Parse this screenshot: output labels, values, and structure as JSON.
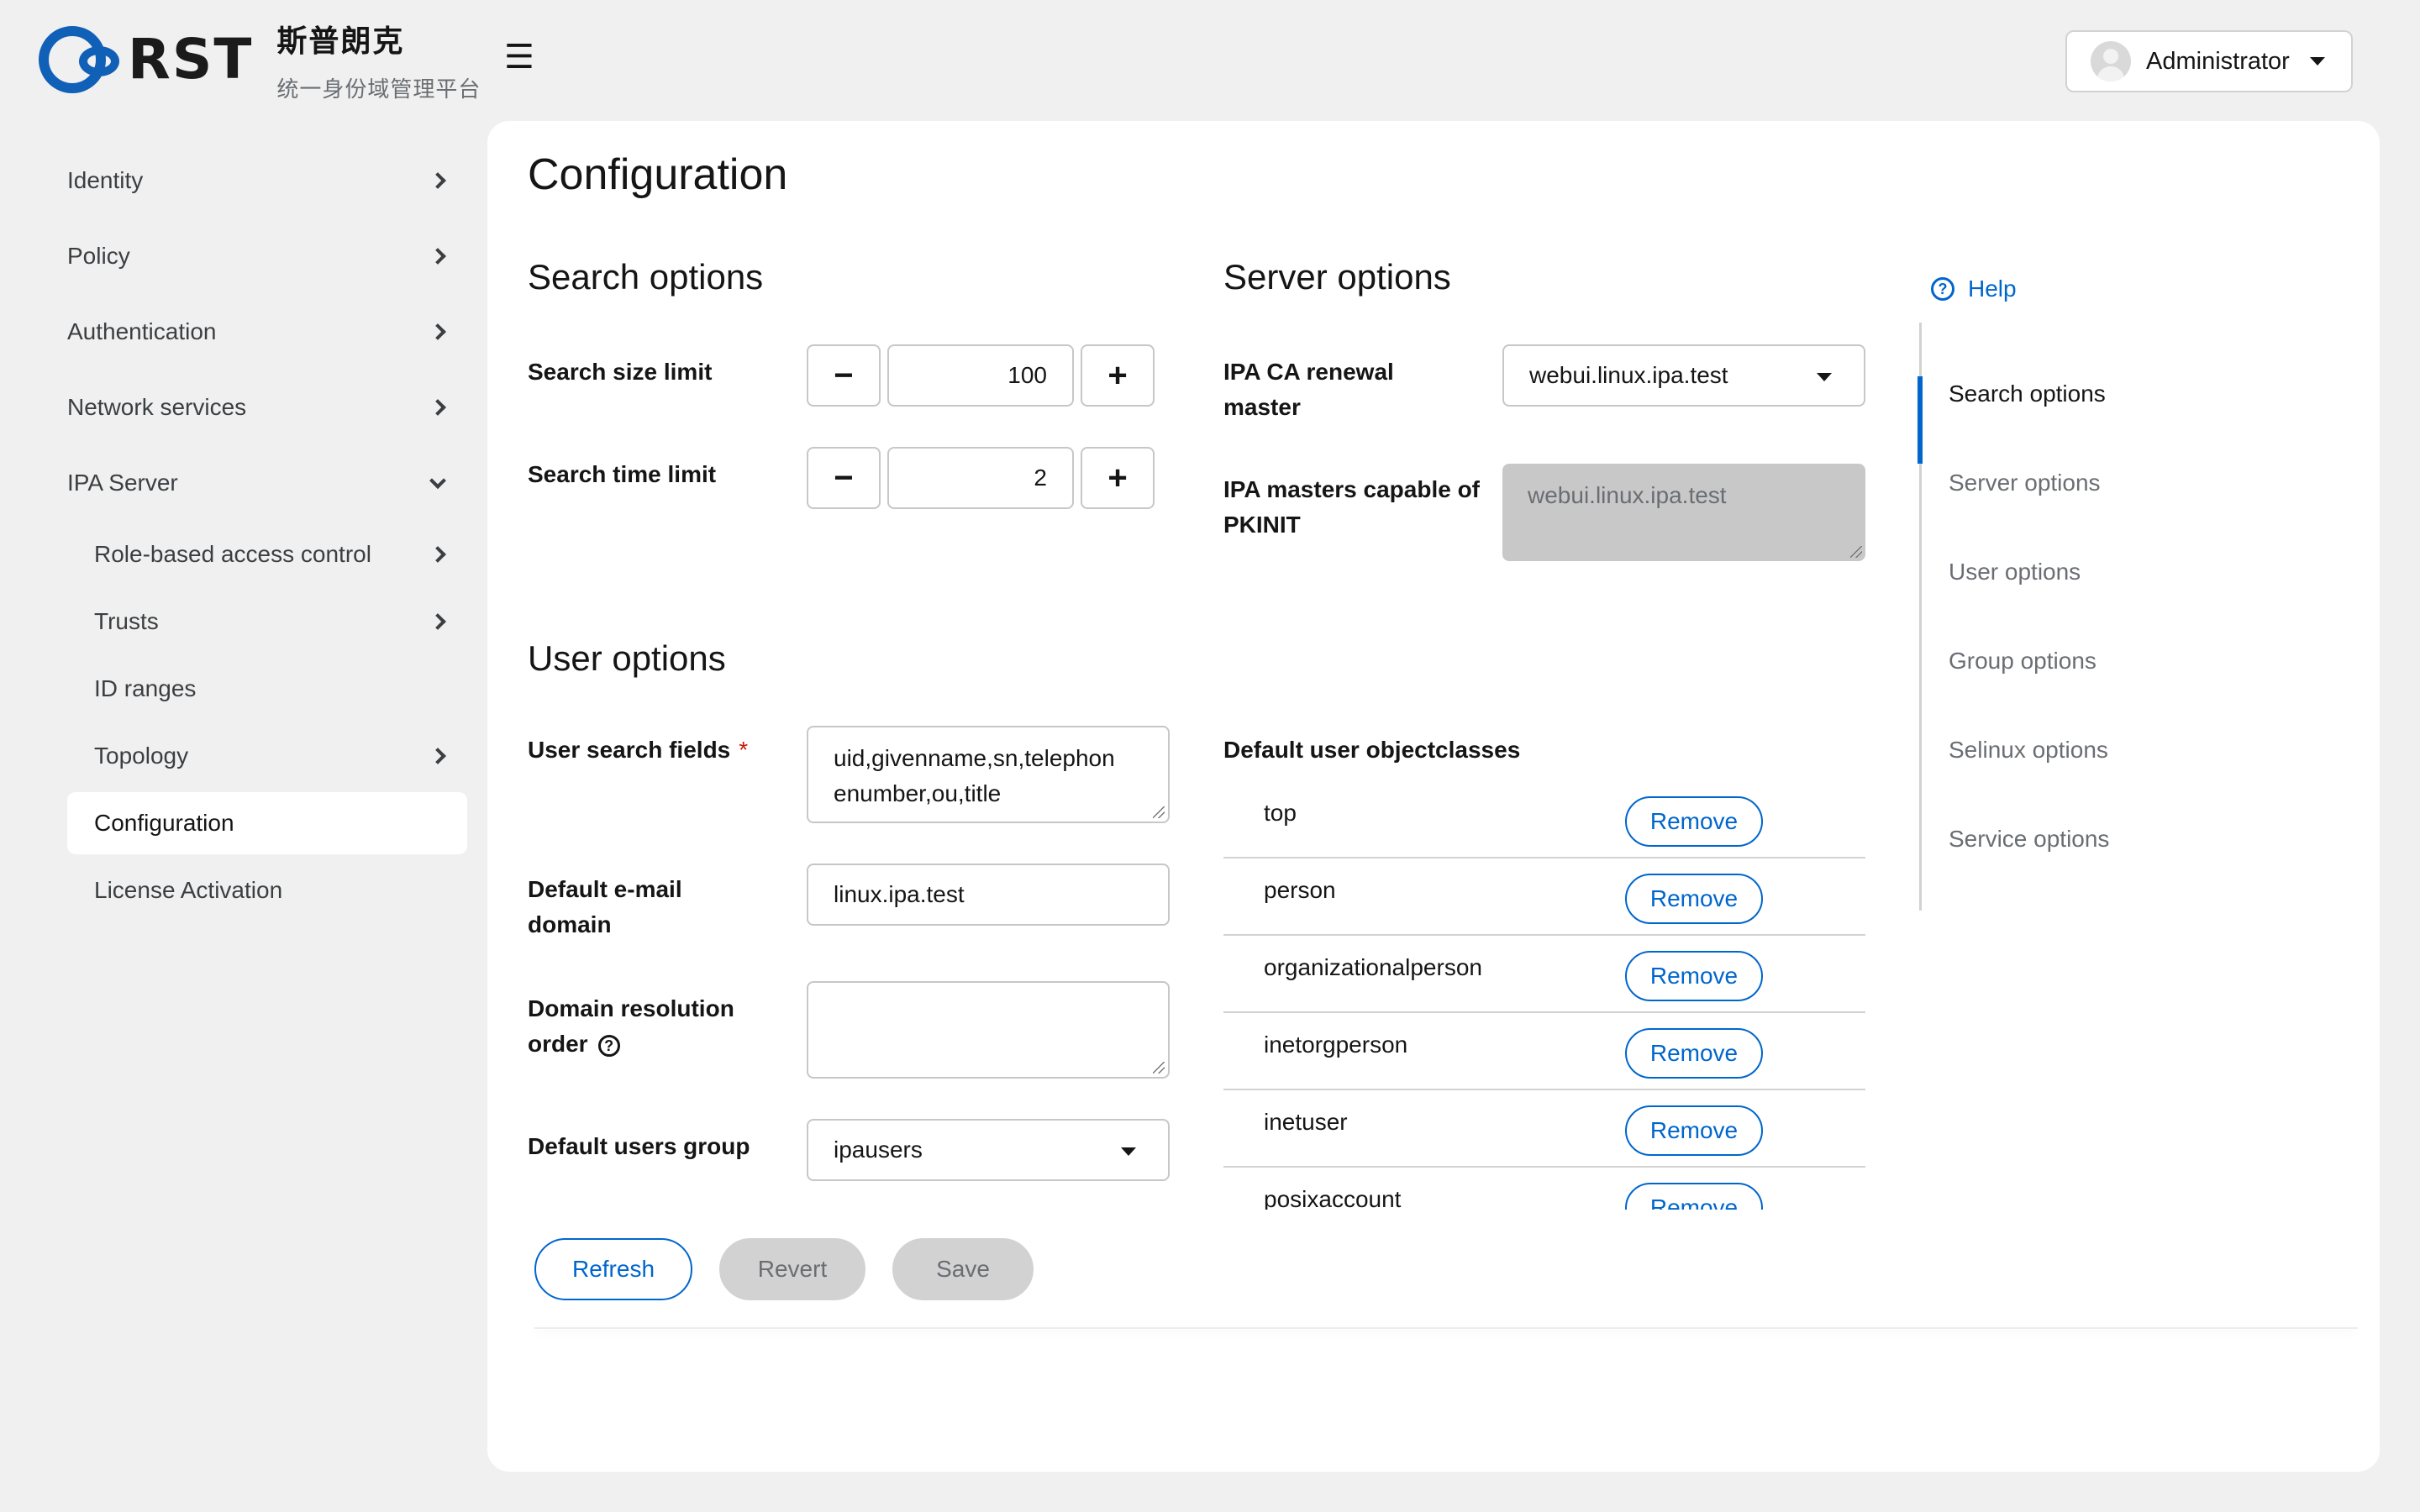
{
  "brand": {
    "logo_text": "RST",
    "name_cn": "斯普朗克",
    "subtitle_cn": "统一身份域管理平台"
  },
  "header": {
    "menu_icon": "☰",
    "user": "Administrator"
  },
  "sidebar": {
    "items": [
      {
        "label": "Identity"
      },
      {
        "label": "Policy"
      },
      {
        "label": "Authentication"
      },
      {
        "label": "Network services"
      },
      {
        "label": "IPA Server"
      }
    ],
    "sub_items": [
      {
        "label": "Role-based access control"
      },
      {
        "label": "Trusts"
      },
      {
        "label": "ID ranges"
      },
      {
        "label": "Topology"
      },
      {
        "label": "Configuration"
      },
      {
        "label": "License Activation"
      }
    ]
  },
  "page": {
    "title": "Configuration"
  },
  "search_options": {
    "title": "Search options",
    "size_label": "Search size limit",
    "size_value": "100",
    "time_label": "Search time limit",
    "time_value": "2",
    "minus": "−",
    "plus": "+"
  },
  "server_options": {
    "title": "Server options",
    "ca_label_1": "IPA CA renewal",
    "ca_label_2": "master",
    "ca_value": "webui.linux.ipa.test",
    "pkinit_label_1": "IPA masters capable of",
    "pkinit_label_2": "PKINIT",
    "pkinit_value": "webui.linux.ipa.test"
  },
  "user_options": {
    "title": "User options",
    "search_fields_label": "User search fields",
    "required_mark": "*",
    "search_fields_line1": "uid,givenname,sn,telephon",
    "search_fields_line2": "enumber,ou,title",
    "email_label_1": "Default e-mail",
    "email_label_2": "domain",
    "email_value": "linux.ipa.test",
    "resolution_label_1": "Domain resolution",
    "resolution_label_2": "order",
    "resolution_value": "",
    "group_label": "Default users group",
    "group_value": "ipausers",
    "objectclasses_label": "Default user objectclasses",
    "remove_label": "Remove",
    "objectclasses": [
      "top",
      "person",
      "organizationalperson",
      "inetorgperson",
      "inetuser",
      "posixaccount"
    ]
  },
  "actions": {
    "refresh": "Refresh",
    "revert": "Revert",
    "save": "Save"
  },
  "jump_nav": {
    "help": "Help",
    "items": [
      "Search options",
      "Server options",
      "User options",
      "Group options",
      "Selinux options",
      "Service options"
    ]
  },
  "colors": {
    "accent": "#0066cc",
    "brand": "#1060b8",
    "required": "#c9190b"
  }
}
